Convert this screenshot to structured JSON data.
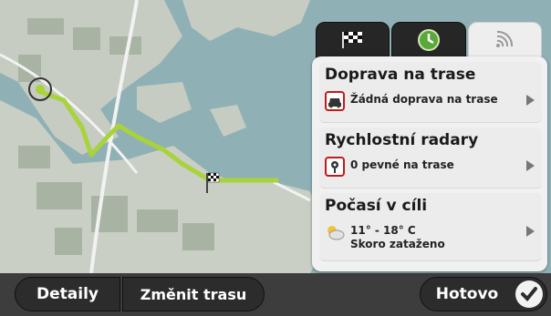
{
  "panel": {
    "tabs": [
      {
        "icon": "checkered-flag-icon",
        "active": false
      },
      {
        "icon": "route-clock-icon",
        "active": false
      },
      {
        "icon": "live-signal-icon",
        "active": true
      }
    ],
    "items": [
      {
        "title": "Doprava na trase",
        "sub_line1": "Žádná doprava na trase",
        "sub_line2": "",
        "icon": "traffic-car-icon"
      },
      {
        "title": "Rychlostní radary",
        "sub_line1": "0 pevné na trase",
        "sub_line2": "",
        "icon": "speed-camera-icon"
      },
      {
        "title": "Počasí v cíli",
        "sub_line1": "11° - 18° C",
        "sub_line2": "Skoro zataženo",
        "icon": "weather-cloud-sun-icon"
      }
    ]
  },
  "bottom": {
    "details_label": "Detaily",
    "change_route_label": "Změnit trasu",
    "done_label": "Hotovo"
  },
  "colors": {
    "water": "#8fb1b6",
    "land": "#c9cfc4",
    "route": "#a8d33a",
    "panel_bg": "#f1f1f1",
    "button_bg": "#2c2c2c"
  }
}
